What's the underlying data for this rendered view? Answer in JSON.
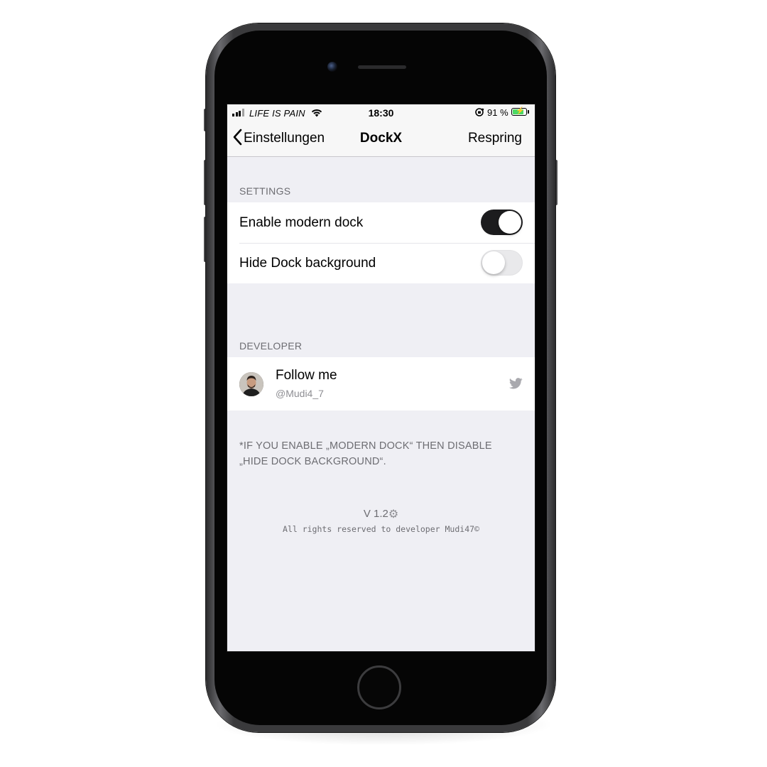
{
  "status_bar": {
    "carrier": "LIFE IS PAIN",
    "time": "18:30",
    "battery_percent": "91 %",
    "battery_level": 0.91,
    "battery_color": "#4cd964",
    "icons": [
      "signal-bars-icon",
      "wifi-icon",
      "orientation-lock-icon",
      "battery-charging-icon"
    ]
  },
  "nav": {
    "back_label": "Einstellungen",
    "title": "DockX",
    "action_label": "Respring"
  },
  "settings": {
    "header": "SETTINGS",
    "items": [
      {
        "label": "Enable modern dock",
        "enabled": true
      },
      {
        "label": "Hide Dock background",
        "enabled": false
      }
    ]
  },
  "developer": {
    "header": "DEVELOPER",
    "follow_title": "Follow me",
    "handle": "@Mudi4_7",
    "icon": "twitter-icon"
  },
  "footer": {
    "note": "*IF YOU ENABLE „MODERN DOCK“ THEN DISABLE „HIDE DOCK BACKGROUND“.",
    "version": "V 1.2",
    "rights": "All rights reserved to developer Mudi47©"
  },
  "colors": {
    "toggle_on": "#1c1c1e",
    "toggle_off": "#e9e9eb",
    "background": "#efeff4"
  }
}
